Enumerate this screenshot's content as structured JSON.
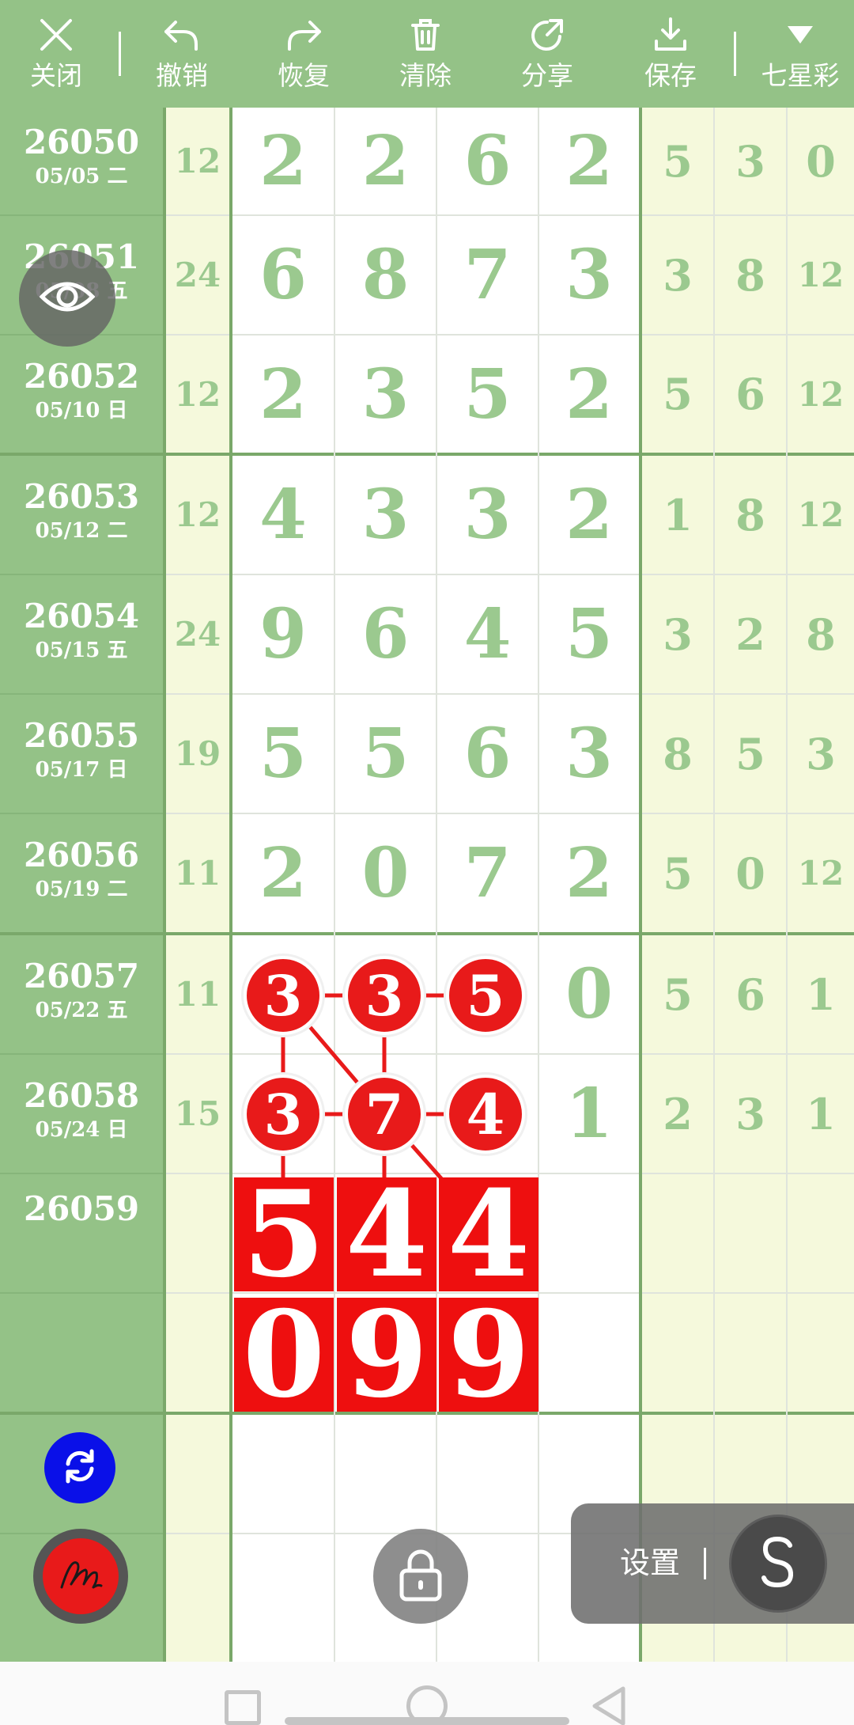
{
  "toolbar": {
    "close": "关闭",
    "undo": "撤销",
    "redo": "恢复",
    "clear": "清除",
    "share": "分享",
    "save": "保存",
    "lottery": "七星彩"
  },
  "rows": [
    {
      "issue": "26050",
      "date": "05/05 二",
      "sum": "12",
      "digits": [
        "2",
        "2",
        "6",
        "2"
      ],
      "tail": [
        "5",
        "3",
        "0"
      ]
    },
    {
      "issue": "26051",
      "date": "05/08 五",
      "sum": "24",
      "digits": [
        "6",
        "8",
        "7",
        "3"
      ],
      "tail": [
        "3",
        "8",
        "12"
      ]
    },
    {
      "issue": "26052",
      "date": "05/10 日",
      "sum": "12",
      "digits": [
        "2",
        "3",
        "5",
        "2"
      ],
      "tail": [
        "5",
        "6",
        "12"
      ]
    },
    {
      "issue": "26053",
      "date": "05/12 二",
      "sum": "12",
      "digits": [
        "4",
        "3",
        "3",
        "2"
      ],
      "tail": [
        "1",
        "8",
        "12"
      ]
    },
    {
      "issue": "26054",
      "date": "05/15 五",
      "sum": "24",
      "digits": [
        "9",
        "6",
        "4",
        "5"
      ],
      "tail": [
        "3",
        "2",
        "8"
      ]
    },
    {
      "issue": "26055",
      "date": "05/17 日",
      "sum": "19",
      "digits": [
        "5",
        "5",
        "6",
        "3"
      ],
      "tail": [
        "8",
        "5",
        "3"
      ]
    },
    {
      "issue": "26056",
      "date": "05/19 二",
      "sum": "11",
      "digits": [
        "2",
        "0",
        "7",
        "2"
      ],
      "tail": [
        "5",
        "0",
        "12"
      ]
    },
    {
      "issue": "26057",
      "date": "05/22 五",
      "sum": "11",
      "digits": [
        "3",
        "3",
        "5",
        "0"
      ],
      "tail": [
        "5",
        "6",
        "1"
      ]
    },
    {
      "issue": "26058",
      "date": "05/24 日",
      "sum": "15",
      "digits": [
        "3",
        "7",
        "4",
        "1"
      ],
      "tail": [
        "2",
        "3",
        "1"
      ]
    },
    {
      "issue": "26059",
      "date": "",
      "sum": "",
      "digits": [
        "",
        "",
        "",
        ""
      ],
      "tail": [
        "",
        "",
        ""
      ]
    }
  ],
  "prediction": {
    "row1": [
      "5",
      "4",
      "4"
    ],
    "row2": [
      "0",
      "9",
      "9"
    ]
  },
  "settings": {
    "label": "设置"
  },
  "colors": {
    "toolbar": "#94c287",
    "label_column": "#94c287",
    "sum_column": "#f5f9dc",
    "tail_columns": "#f5f9dc",
    "digit_text": "#9bc98f",
    "highlight_red": "#ee0f0f",
    "blue_button": "#0a10e8"
  }
}
